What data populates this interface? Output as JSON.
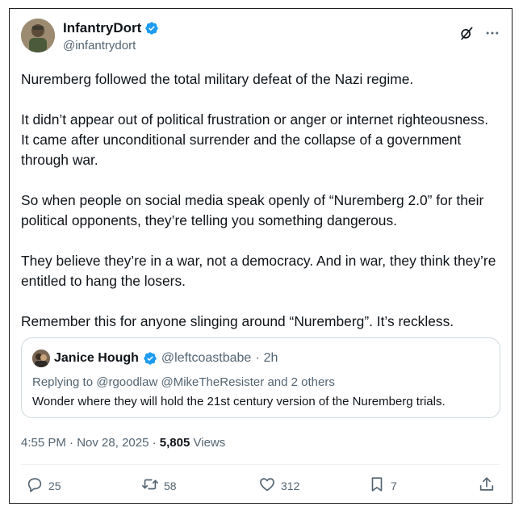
{
  "author": {
    "display_name": "InfantryDort",
    "handle": "@infantrydort",
    "verified": true
  },
  "top_icons": [
    "grok-icon",
    "more-icon"
  ],
  "post": {
    "paragraphs": [
      "Nuremberg followed the total military defeat of the Nazi regime.",
      "It didn’t appear out of political frustration or anger or internet righteousness. It came after unconditional surrender and the collapse of a government through war.",
      "So when people on social media speak openly of “Nuremberg 2.0” for their political opponents, they’re telling you something dangerous.",
      "They believe they’re in a war, not a democracy. And in war, they think they’re entitled to hang the losers.",
      "Remember this for anyone slinging around “Nuremberg”. It’s reckless."
    ]
  },
  "quote": {
    "display_name": "Janice Hough",
    "handle": "@leftcoastbabe",
    "separator": "·",
    "time": "2h",
    "replying_prefix": "Replying to",
    "replying_users": [
      "@rgoodlaw",
      "@MikeTheResister"
    ],
    "replying_and": "and",
    "replying_others": "2 others",
    "text": "Wonder where they will hold the 21st century version of the Nuremberg trials."
  },
  "meta": {
    "time": "4:55 PM",
    "separator": "·",
    "date": "Nov 28, 2025",
    "views_count": "5,805",
    "views_label": "Views"
  },
  "actions": {
    "replies": "25",
    "reposts": "58",
    "likes": "312",
    "bookmarks": "7"
  },
  "colors": {
    "verified": "#1d9bf0",
    "text": "#0f1419",
    "muted": "#536471",
    "quote_border": "#cfd9de"
  }
}
